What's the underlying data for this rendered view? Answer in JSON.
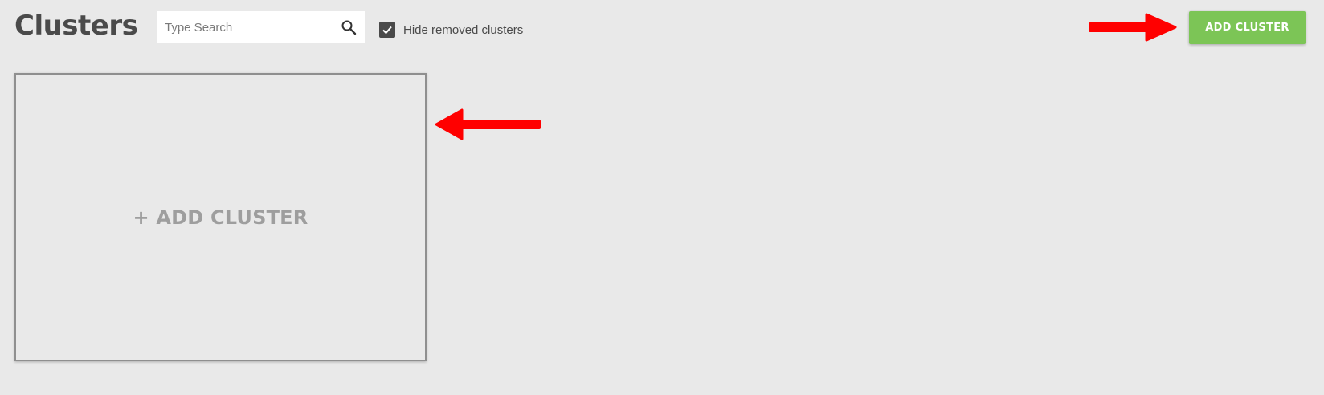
{
  "header": {
    "title": "Clusters",
    "search": {
      "placeholder": "Type Search",
      "value": "",
      "icon": "search-icon"
    },
    "hide_removed": {
      "label": "Hide removed clusters",
      "checked": true,
      "icon": "checkmark-icon"
    },
    "add_button_label": "ADD CLUSTER"
  },
  "main": {
    "add_card_label": "+ ADD CLUSTER"
  },
  "colors": {
    "background": "#e9e9e9",
    "accent_green": "#7cc556",
    "annotation_red": "#ff0000",
    "title_text": "#4a4a4a",
    "card_label": "#9e9e9e"
  }
}
